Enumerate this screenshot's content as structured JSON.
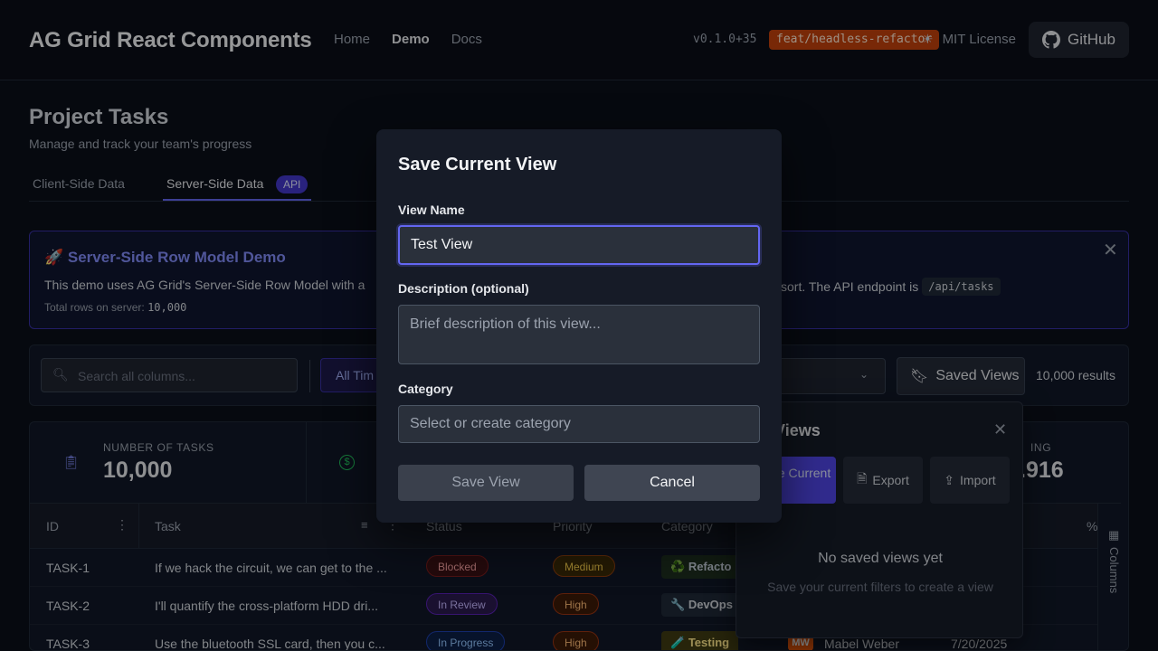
{
  "header": {
    "brand": "AG Grid React Components",
    "nav": [
      "Home",
      "Demo",
      "Docs"
    ],
    "version": "v0.1.0+35",
    "branch": "feat/headless-refactor",
    "license": "MIT License",
    "github": "GitHub"
  },
  "page": {
    "title": "Project Tasks",
    "subtitle": "Manage and track your team's progress",
    "tabs": [
      {
        "label": "Client-Side Data"
      },
      {
        "label": "Server-Side Data",
        "badge": "API"
      }
    ]
  },
  "info": {
    "title": "🚀 Server-Side Row Model Demo",
    "text_left": "This demo uses AG Grid's Server-Side Row Model with a",
    "text_right": "sort. The API endpoint is",
    "endpoint": "/api/tasks",
    "total_label": "Total rows on server:",
    "total_value": "10,000"
  },
  "toolbar": {
    "search_placeholder": "Search all columns...",
    "time_filter": "All Tim",
    "filters_partial": "rs",
    "saved_views": "Saved Views",
    "results": "10,000 results"
  },
  "stats": {
    "tasks_label": "NUMBER OF TASKS",
    "tasks_value": "10,000",
    "right_label": "ING",
    "right_value": ".916"
  },
  "grid": {
    "columns": [
      "ID",
      "Task",
      "Status",
      "Priority",
      "Category",
      "%"
    ],
    "rows": [
      {
        "id": "TASK-1",
        "task": "If we hack the circuit, we can get to the ...",
        "status": "Blocked",
        "priority": "Medium",
        "category": "Refacto",
        "category_icon": "♻️"
      },
      {
        "id": "TASK-2",
        "task": "I'll quantify the cross-platform HDD dri...",
        "status": "In Review",
        "priority": "High",
        "category": "DevOps",
        "category_icon": "🔧"
      },
      {
        "id": "TASK-3",
        "task": "Use the bluetooth SSL card, then you c...",
        "status": "In Progress",
        "priority": "High",
        "category": "Testing",
        "category_icon": "🧪",
        "assignee_initials": "MW",
        "assignee": "Mabel Weber",
        "date": "7/20/2025"
      }
    ],
    "side_panel": "Columns"
  },
  "saved_views_panel": {
    "title": "ed Views",
    "save_current": "Save Current",
    "export": "Export",
    "import": "Import",
    "empty_title": "No saved views yet",
    "empty_sub": "Save your current filters to create a view"
  },
  "dialog": {
    "title": "Save Current View",
    "name_label": "View Name",
    "name_value": "Test View",
    "description_label": "Description (optional)",
    "description_placeholder": "Brief description of this view...",
    "category_label": "Category",
    "category_placeholder": "Select or create category",
    "save_button": "Save View",
    "cancel_button": "Cancel"
  }
}
